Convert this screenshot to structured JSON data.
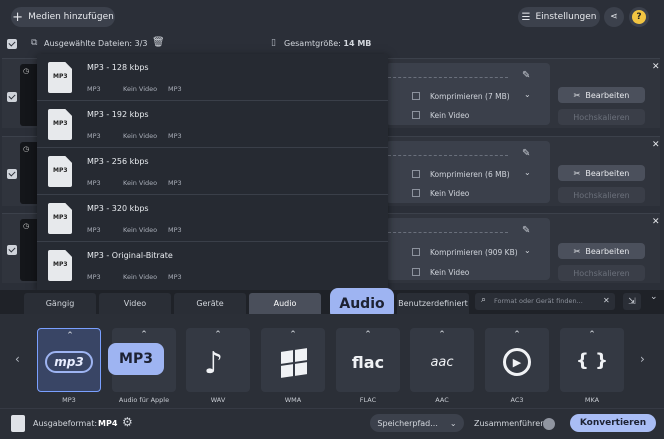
{
  "toolbar": {
    "add_media": "Medien hinzufügen",
    "settings": "Einstellungen",
    "help": "?"
  },
  "selection": {
    "selected_files": "Ausgewählte Dateien: 3/3",
    "total_size_label": "Gesamtgröße:",
    "total_size_value": "14 MB"
  },
  "rows": [
    {
      "compress": "Komprimieren (7 MB)",
      "video": "Kein Video",
      "edit": "Bearbeiten",
      "scale": "Hochskalieren"
    },
    {
      "compress": "Komprimieren (6 MB)",
      "video": "Kein Video",
      "edit": "Bearbeiten",
      "scale": "Hochskalieren"
    },
    {
      "compress": "Komprimieren (909 KB)",
      "video": "Kein Video",
      "edit": "Bearbeiten",
      "scale": "Hochskalieren"
    }
  ],
  "presets": [
    {
      "title": "MP3 - 128 kbps",
      "a": "MP3",
      "b": "Kein Video",
      "c": "MP3"
    },
    {
      "title": "MP3 - 192 kbps",
      "a": "MP3",
      "b": "Kein Video",
      "c": "MP3"
    },
    {
      "title": "MP3 - 256 kbps",
      "a": "MP3",
      "b": "Kein Video",
      "c": "MP3"
    },
    {
      "title": "MP3 - 320 kbps",
      "a": "MP3",
      "b": "Kein Video",
      "c": "MP3"
    },
    {
      "title": "MP3 - Original-Bitrate",
      "a": "MP3",
      "b": "Kein Video",
      "c": "MP3"
    }
  ],
  "preset_icon_text": "MP3",
  "tabs": [
    "Gängig",
    "Video",
    "Geräte",
    "Audio",
    "Benutzerdefiniert"
  ],
  "search_placeholder": "Format oder Gerät finden...",
  "callouts": {
    "audio": "Audio",
    "mp3": "MP3"
  },
  "formats": [
    "MP3",
    "Audio für Apple",
    "WAV",
    "WMA",
    "FLAC",
    "AAC",
    "AC3",
    "MKA"
  ],
  "format_icons": {
    "mp3": "mp3",
    "flac": "flac",
    "aac": "aac"
  },
  "bottom": {
    "output_label": "Ausgabeformat:",
    "output_value": "MP4",
    "save_path": "Speicherpfad...",
    "merge": "Zusammenführen:",
    "convert": "Konvertieren"
  },
  "colors": {
    "accent": "#9eb4f2",
    "convert": "#a9bdf5"
  }
}
